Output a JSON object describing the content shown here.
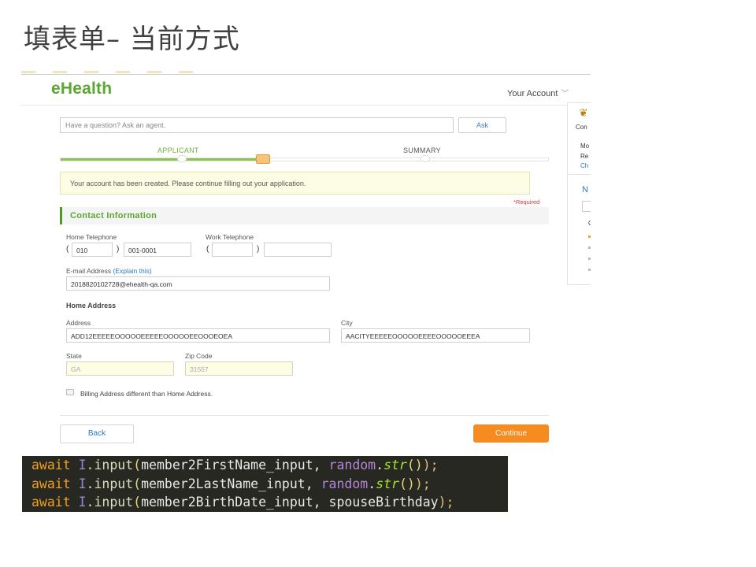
{
  "slide": {
    "title": "填表单– 当前方式"
  },
  "app": {
    "logo": "eHealth",
    "account_menu": "Your Account",
    "account_chevron": "chevron-down-icon"
  },
  "right_panel": {
    "line1": "Con",
    "line2": "Mo",
    "line3": "Re",
    "line4": "Ch",
    "heading": "N",
    "line6": "C"
  },
  "question": {
    "placeholder": "Have a question? Ask an agent.",
    "ask_label": "Ask"
  },
  "progress": {
    "steps": [
      "APPLICANT",
      "SUMMARY"
    ],
    "current_fraction": 0.41
  },
  "notice": "Your account has been created. Please continue filling out your application.",
  "required_note": "*Required",
  "section_title": "Contact Information",
  "form": {
    "home_phone": {
      "label": "Home Telephone",
      "area": "010",
      "number": "001-0001",
      "open_paren": "(",
      "close_paren": ")"
    },
    "work_phone": {
      "label": "Work Telephone",
      "area": "",
      "number": "",
      "open_paren": "(",
      "close_paren": ")"
    },
    "email": {
      "label": "E-mail Address",
      "explain_link": "(Explain this)",
      "value": "2018820102728@ehealth-qa.com"
    },
    "home_address_heading": "Home Address",
    "address": {
      "label": "Address",
      "value": "ADD12EEEEEOOOOOEEEEEOOOOOEEOOOEOEA"
    },
    "city": {
      "label": "City",
      "value": "AACITYEEEEEOOOOOEEEEOOOOOEEEA"
    },
    "state": {
      "label": "State",
      "value": "GA"
    },
    "zip": {
      "label": "Zip Code",
      "value": "31557"
    },
    "billing_checkbox_label": "Billing Address different than Home Address.",
    "billing_checked": false
  },
  "buttons": {
    "back": "Back",
    "continue": "Continue"
  },
  "code": {
    "lines": [
      {
        "kw": "await",
        "obj": "I",
        "dot": ".",
        "fn": "input",
        "open": "(",
        "arg": "member2FirstName_input",
        "comma": ", ",
        "rnd": "random",
        "dot2": ".",
        "str": "str",
        "call": "()",
        "close": ");"
      },
      {
        "kw": "await",
        "obj": "I",
        "dot": ".",
        "fn": "input",
        "open": "(",
        "arg": "member2LastName_input",
        "comma": ", ",
        "rnd": "random",
        "dot2": ".",
        "str": "str",
        "call": "()",
        "close": ");"
      },
      {
        "kw": "await",
        "obj": "I",
        "dot": ".",
        "fn": "input",
        "open": "(",
        "arg": "member2BirthDate_input",
        "comma": ", ",
        "arg2": "spouseBirthday",
        "close": ");"
      }
    ]
  },
  "colors": {
    "brand_green": "#5aa731",
    "accent_orange": "#f68b1f",
    "link_blue": "#2a7bc0",
    "code_bg": "#272822"
  }
}
